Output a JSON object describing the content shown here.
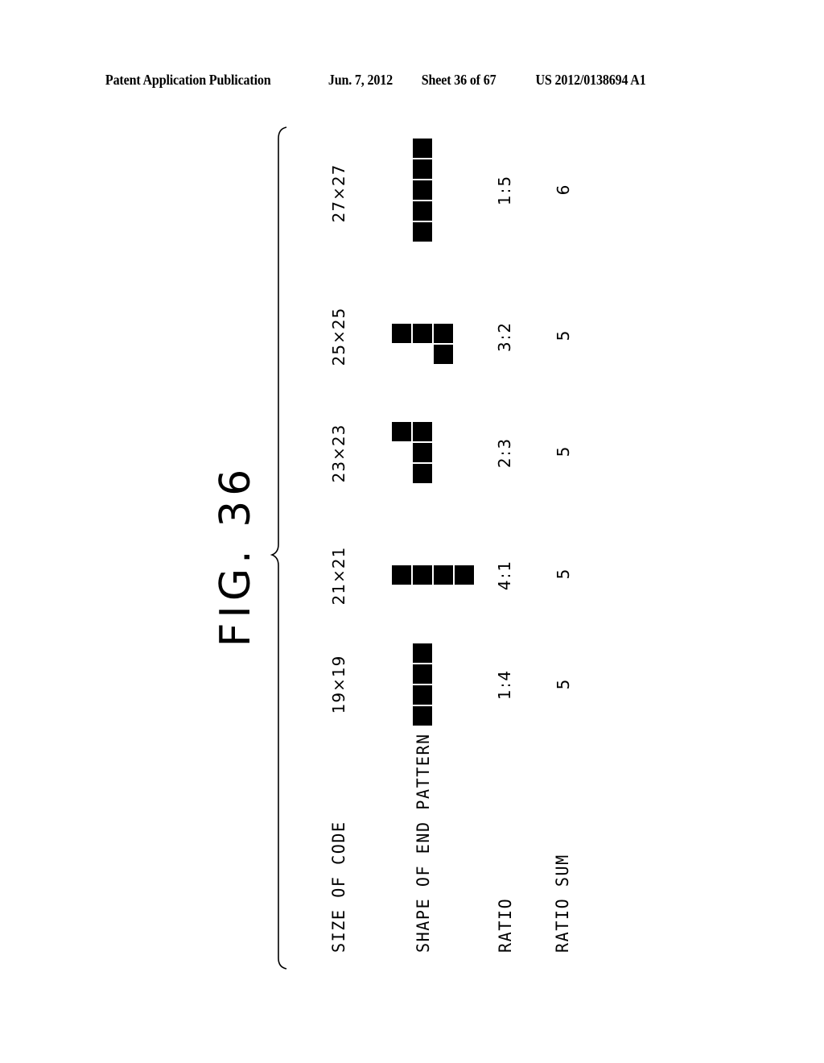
{
  "header": {
    "publication": "Patent Application Publication",
    "date": "Jun. 7, 2012",
    "sheet": "Sheet 36 of 67",
    "patent_number": "US 2012/0138694 A1"
  },
  "figure": {
    "title": "FIG. 36"
  },
  "table": {
    "row_labels": {
      "size": "SIZE OF CODE",
      "shape": "SHAPE OF END PATTERN",
      "ratio": "RATIO",
      "ratio_sum": "RATIO SUM"
    },
    "columns": [
      {
        "size": "19×19",
        "shape": [
          [
            1
          ],
          [
            1
          ],
          [
            1
          ],
          [
            1
          ]
        ],
        "shape_description": "vertical column of 4 modules",
        "ratio": "1:4",
        "ratio_sum": "5"
      },
      {
        "size": "21×21",
        "shape": [
          [
            1,
            1,
            1,
            1
          ]
        ],
        "shape_description": "horizontal row of 4 modules",
        "ratio": "4:1",
        "ratio_sum": "5"
      },
      {
        "size": "23×23",
        "shape": [
          [
            1,
            1
          ],
          [
            0,
            1
          ],
          [
            0,
            1
          ]
        ],
        "shape_description": "2 modules wide, 3 modules tall L-shape",
        "ratio": "2:3",
        "ratio_sum": "5"
      },
      {
        "size": "25×25",
        "shape": [
          [
            1,
            1,
            1
          ],
          [
            0,
            0,
            1
          ]
        ],
        "shape_description": "3 modules wide, 2 modules tall L-shape",
        "ratio": "3:2",
        "ratio_sum": "5"
      },
      {
        "size": "27×27",
        "shape": [
          [
            1
          ],
          [
            1
          ],
          [
            1
          ],
          [
            1
          ],
          [
            1
          ]
        ],
        "shape_description": "vertical column of 5 modules",
        "ratio": "1:5",
        "ratio_sum": "6"
      }
    ]
  }
}
